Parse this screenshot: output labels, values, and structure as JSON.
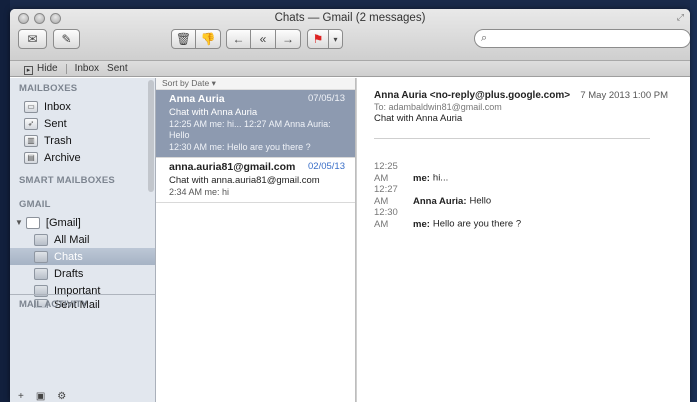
{
  "window": {
    "title": "Chats — Gmail (2 messages)"
  },
  "toolbar": {
    "icons": [
      "compose-envelope-icon",
      "new-note-icon",
      "trash-icon",
      "junk-icon",
      "reply-icon",
      "reply-all-icon",
      "forward-icon",
      "flag-icon",
      "chevron-down-icon"
    ],
    "search_placeholder": ""
  },
  "favorites_bar": {
    "hide": "Hide",
    "items": [
      "Inbox",
      "Sent"
    ]
  },
  "sidebar": {
    "mailboxes_heading": "MAILBOXES",
    "mailboxes": [
      {
        "label": "Inbox",
        "icon": "inbox-icon"
      },
      {
        "label": "Sent",
        "icon": "sent-icon"
      },
      {
        "label": "Trash",
        "icon": "trash-icon"
      },
      {
        "label": "Archive",
        "icon": "archive-icon"
      }
    ],
    "smart_heading": "SMART MAILBOXES",
    "gmail_heading": "GMAIL",
    "gmail_root": "[Gmail]",
    "folders": [
      {
        "label": "All Mail",
        "selected": false
      },
      {
        "label": "Chats",
        "selected": true
      },
      {
        "label": "Drafts",
        "selected": false
      },
      {
        "label": "Important",
        "selected": false
      },
      {
        "label": "Sent Mail",
        "selected": false
      }
    ],
    "activity_heading": "MAIL ACTIVITY",
    "bottom_icons": [
      "plus-icon",
      "mailbox-icon",
      "gear-icon"
    ]
  },
  "message_list": {
    "sort_label": "Sort by Date ▾",
    "messages": [
      {
        "from": "Anna Auria",
        "date": "07/05/13",
        "subject": "Chat with Anna Auria",
        "preview1": "12:25 AM me: hi... 12:27 AM Anna Auria: Hello",
        "preview2": "12:30 AM me: Hello are you there ?",
        "selected": true
      },
      {
        "from": "anna.auria81@gmail.com",
        "date": "02/05/13",
        "subject": "Chat with anna.auria81@gmail.com",
        "preview1": "2:34 AM me: hi",
        "preview2": "",
        "selected": false
      }
    ]
  },
  "reader": {
    "from": "Anna Auria <no-reply@plus.google.com>",
    "date": "7 May 2013 1:00 PM",
    "to_label": "To:",
    "to": "adambaldwin81@gmail.com",
    "subject": "Chat with Anna Auria",
    "chat": [
      {
        "time": "12:25 AM",
        "who": "me:",
        "text": "hi..."
      },
      {
        "time": "12:27 AM",
        "who": "Anna Auria:",
        "text": "Hello"
      },
      {
        "time": "12:30 AM",
        "who": "me:",
        "text": "Hello are you there ?"
      }
    ]
  }
}
